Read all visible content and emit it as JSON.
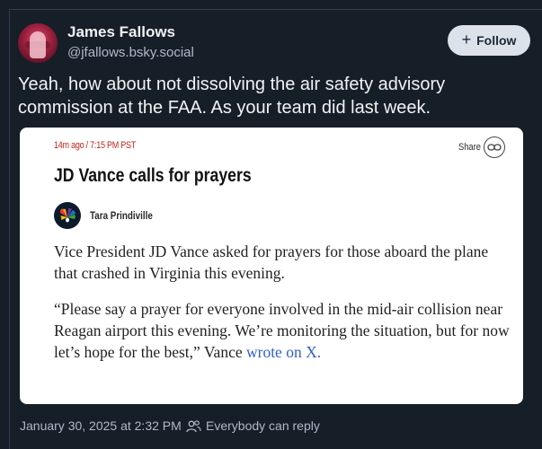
{
  "post": {
    "author_name": "James Fallows",
    "author_handle": "@jfallows.bsky.social",
    "follow_label": "Follow",
    "text": "Yeah, how about not dissolving the air safety advisory commission at the FAA. As your team did last week.",
    "timestamp": "January 30, 2025 at 2:32 PM",
    "reply_setting": "Everybody can reply"
  },
  "embed": {
    "meta": "14m ago / 7:15 PM PST",
    "share_label": "Share",
    "headline": "JD Vance calls for prayers",
    "author": "Tara Prindiville",
    "paragraph1": "Vice President JD Vance asked for prayers for those aboard the plane that crashed in Virginia this evening.",
    "paragraph2_text": "“Please say a prayer for everyone involved in the mid-air collision near Reagan airport this evening. We’re monitoring the situation, but for now let’s hope for the best,” Vance ",
    "paragraph2_link": "wrote on X."
  },
  "icons": {
    "share": "link-icon",
    "reply": "people-icon",
    "follow": "plus-icon"
  },
  "colors": {
    "background": "#161e27",
    "follow_button": "#dce2ea",
    "meta_red": "#c6241c",
    "link_blue": "#2f5fc6"
  }
}
